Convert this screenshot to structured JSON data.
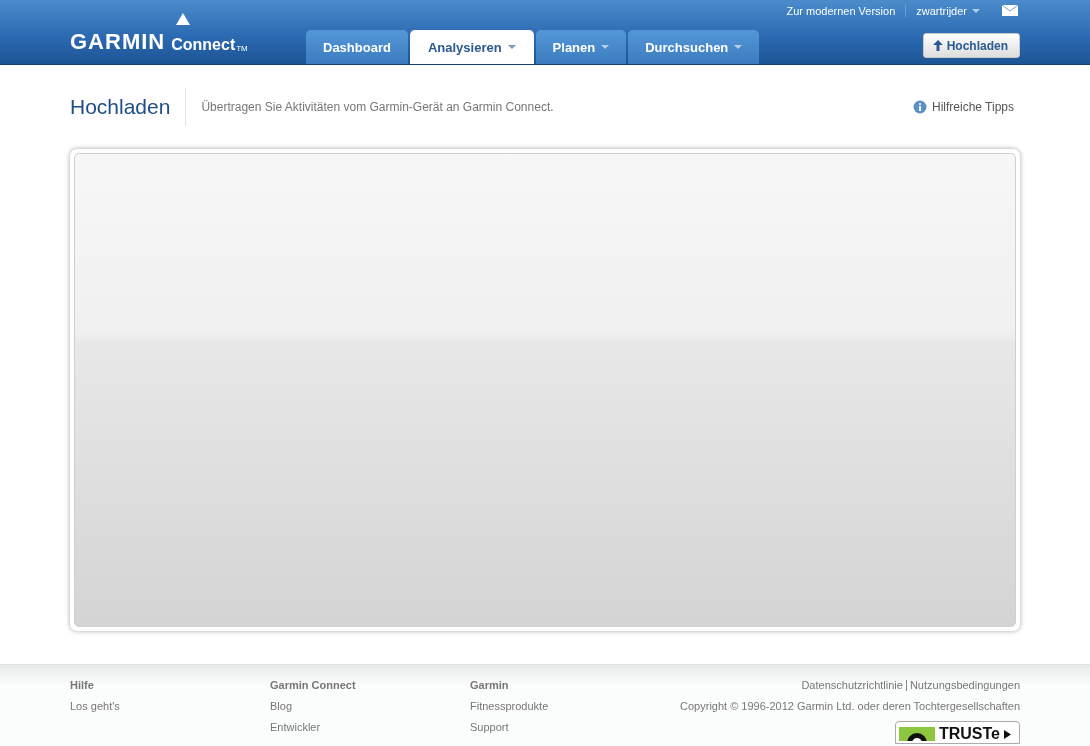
{
  "header": {
    "logo": {
      "brand": "GARMIN",
      "product": "Connect",
      "trademark": "TM"
    },
    "top_links": [
      {
        "label": "Zur modernen Version",
        "has_menu": false
      },
      {
        "label": "zwartrijder",
        "has_menu": true
      }
    ],
    "tabs": [
      {
        "label": "Dashboard",
        "selected": false,
        "has_menu": false
      },
      {
        "label": "Analysieren",
        "selected": true,
        "has_menu": true
      },
      {
        "label": "Planen",
        "selected": false,
        "has_menu": true
      },
      {
        "label": "Durchsuchen",
        "selected": false,
        "has_menu": true
      }
    ],
    "upload_button": "Hochladen"
  },
  "page": {
    "title": "Hochladen",
    "subtitle": "Übertragen Sie Aktivitäten vom Garmin-Gerät an Garmin Connect.",
    "help_link": "Hilfreiche Tipps"
  },
  "footer": {
    "columns": [
      {
        "heading": "Hilfe",
        "links": [
          "Los geht's"
        ]
      },
      {
        "heading": "Garmin Connect",
        "links": [
          "Blog",
          "Entwickler"
        ]
      },
      {
        "heading": "Garmin",
        "links": [
          "Fitnessprodukte",
          "Support"
        ]
      }
    ],
    "legal_links": [
      "Datenschutzrichtlinie",
      "Nutzungsbedingungen"
    ],
    "copyright": "Copyright © 1996-2012 Garmin Ltd. oder deren Tochtergesellschaften",
    "badge": "TRUSTe"
  }
}
